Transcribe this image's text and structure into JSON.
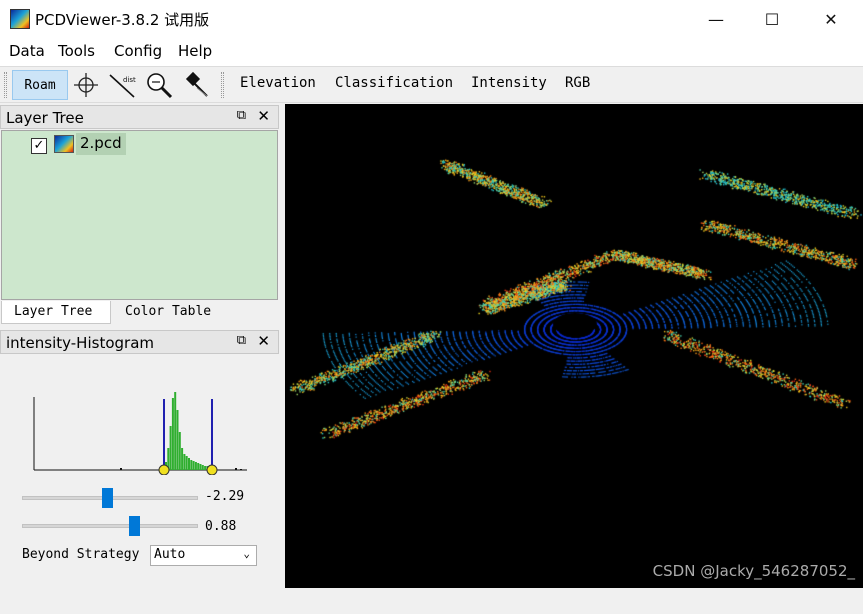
{
  "window": {
    "title": "PCDViewer-3.8.2 试用版",
    "minimize": "—",
    "maximize": "☐",
    "close": "✕"
  },
  "menu": [
    "Data",
    "Tools",
    "Config",
    "Help"
  ],
  "toolbar": {
    "roam": "Roam",
    "dist_label": "dist",
    "modes": [
      "Elevation",
      "Classification",
      "Intensity",
      "RGB"
    ]
  },
  "layer_tree": {
    "title": "Layer Tree",
    "float_icon": "⧉",
    "close_icon": "✕",
    "items": [
      {
        "label": "2.pcd",
        "checked": "✓"
      }
    ]
  },
  "tabs": [
    "Layer Tree",
    "Color Table"
  ],
  "histogram": {
    "title": "intensity-Histogram",
    "float_icon": "⧉",
    "close_icon": "✕",
    "slider1_value": "-2.29",
    "slider2_value": "0.88",
    "slider1_level": 0.48,
    "slider2_level": 0.64,
    "beyond_label": "Beyond Strategy",
    "beyond_value": "Auto",
    "colors": {
      "bars": "#2fae2f",
      "markers": "#2020b0",
      "handles": "#f0e020"
    }
  },
  "viewport": {
    "background": "#000000",
    "watermark": "CSDN @Jacky_546287052_"
  }
}
